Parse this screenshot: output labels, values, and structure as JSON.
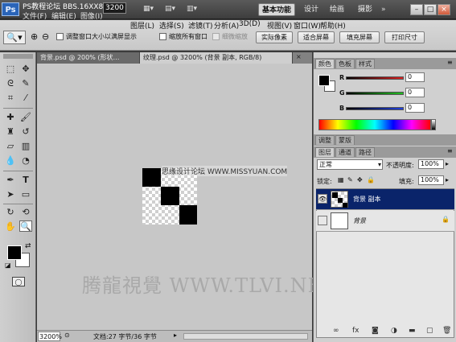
{
  "menubar": {
    "logo": "Ps",
    "menus": [
      "文件(F)",
      "编辑(E)",
      "图像(I)",
      "图层(L)",
      "选择(S)",
      "滤镜(T)",
      "分析(A)",
      "3D(D)",
      "视图(V)",
      "窗口(W)",
      "帮助(H)"
    ],
    "zoom_value": "3200",
    "workspaces": [
      "基本功能",
      "设计",
      "绘画",
      "摄影"
    ],
    "active_workspace": "基本功能",
    "window_buttons": [
      "–",
      "□",
      "×"
    ]
  },
  "watermark_top": "PS教程论坛 BBS.16XX8.COM",
  "options": {
    "checkbox1": "调整窗口大小以满屏显示",
    "checkbox2": "缩放所有窗口",
    "checkbox3": "细微缩放",
    "btn_actual": "实际像素",
    "btn_fit": "适合屏幕",
    "btn_fill": "填充屏幕",
    "btn_print": "打印尺寸"
  },
  "tabs": [
    {
      "label": "背景.psd @ 200% (形状…",
      "active": false
    },
    {
      "label": "纹理.psd @ 3200% (背景 副本, RGB/8)",
      "active": true
    }
  ],
  "canvas_watermark": "思缘设计论坛 WWW.MISSYUAN.COM",
  "bottom_watermark": "腾龍視覺 WWW.TLVI.NET",
  "status": {
    "zoom": "3200%",
    "doc": "文档:27 字节/36 字节"
  },
  "color_panel": {
    "tabs": [
      "颜色",
      "色板",
      "样式"
    ],
    "channels": [
      {
        "label": "R",
        "value": "0",
        "gradient": "#e02020"
      },
      {
        "label": "G",
        "value": "0",
        "gradient": "#20c020"
      },
      {
        "label": "B",
        "value": "0",
        "gradient": "#2040e0"
      }
    ]
  },
  "adjust_panel": {
    "tabs": [
      "调整",
      "蒙版"
    ]
  },
  "layers_panel": {
    "tabs": [
      "图层",
      "通道",
      "路径"
    ],
    "blend_mode": "正常",
    "opacity_label": "不透明度:",
    "opacity_value": "100%",
    "lock_label": "锁定:",
    "fill_label": "填充:",
    "fill_value": "100%",
    "layers": [
      {
        "name": "背景 副本",
        "selected": true
      },
      {
        "name": "背景",
        "selected": false,
        "italic": true
      }
    ],
    "footer_icons": [
      "link-icon",
      "fx-icon",
      "mask-icon",
      "adjustment-icon",
      "group-icon",
      "new-layer-icon",
      "trash-icon"
    ]
  }
}
